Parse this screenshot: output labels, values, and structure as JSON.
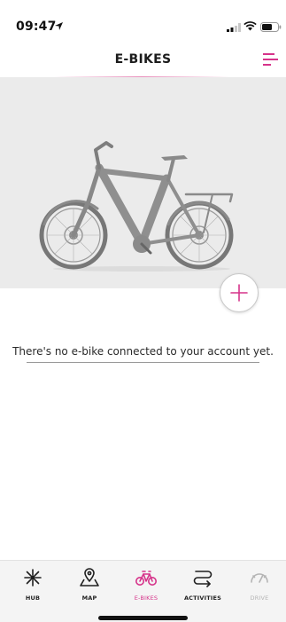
{
  "status_bar": {
    "time": "09:47"
  },
  "header": {
    "title": "E-BIKES"
  },
  "main": {
    "empty_message": "There's no e-bike connected to your account yet."
  },
  "tabbar": {
    "items": [
      {
        "label": "HUB",
        "icon": "hub-icon"
      },
      {
        "label": "MAP",
        "icon": "map-pin-icon"
      },
      {
        "label": "E-BIKES",
        "icon": "bike-icon",
        "active": true
      },
      {
        "label": "ACTIVITIES",
        "icon": "route-icon"
      },
      {
        "label": "DRIVE",
        "icon": "gauge-icon",
        "disabled": true
      }
    ]
  },
  "colors": {
    "accent": "#d6338a",
    "hero_bg": "#ebebeb",
    "tabbar_bg": "#f4f4f4"
  }
}
